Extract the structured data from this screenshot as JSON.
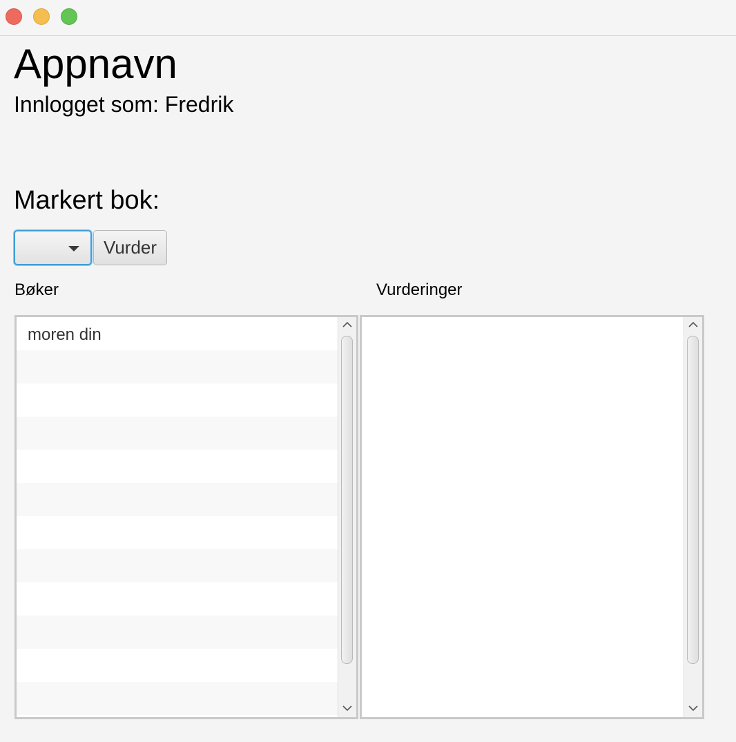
{
  "app": {
    "title": "Appnavn",
    "logged_in_text": "Innlogget som: Fredrik"
  },
  "selection": {
    "label": "Markert bok:",
    "combo_value": "",
    "rate_button_label": "Vurder"
  },
  "books": {
    "header": "Bøker",
    "items": [
      "moren din",
      "",
      "",
      "",
      "",
      "",
      "",
      "",
      "",
      "",
      "",
      ""
    ]
  },
  "ratings": {
    "header": "Vurderinger",
    "items": []
  },
  "icons": {
    "combo_arrow": "chevron-down-icon",
    "scroll_up": "chevron-up-icon",
    "scroll_down": "chevron-down-icon"
  },
  "colors": {
    "window_close": "#ee6a5f",
    "window_minimize": "#f5be4f",
    "window_zoom": "#62c554",
    "focus_accent": "#3f9ed8"
  }
}
